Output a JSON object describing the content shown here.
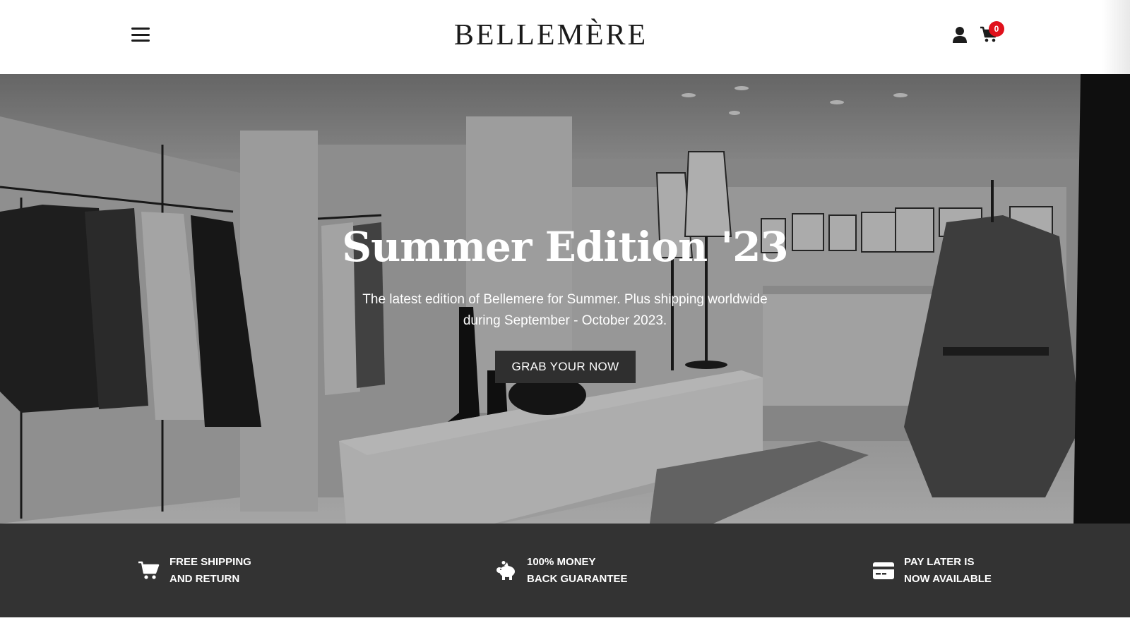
{
  "header": {
    "brand": "BELLEMÈRE",
    "menu_icon": "hamburger-menu-icon",
    "user_icon": "user-icon",
    "cart_icon": "shopping-cart-icon",
    "cart_count": "0"
  },
  "hero": {
    "title": "Summer Edition '23",
    "subtitle_line1": "The latest edition of Bellemere for Summer. Plus shipping worldwide",
    "subtitle_line2": "during September - October 2023.",
    "cta_label": "GRAB YOUR NOW"
  },
  "features": [
    {
      "icon": "cart-icon",
      "line1": "FREE SHIPPING",
      "line2": "AND RETURN"
    },
    {
      "icon": "piggy-bank-icon",
      "line1": "100% MONEY",
      "line2": "BACK GUARANTEE"
    },
    {
      "icon": "credit-card-icon",
      "line1": "PAY LATER IS",
      "line2": "NOW AVAILABLE"
    }
  ],
  "colors": {
    "badge": "#e0101b",
    "feature_band": "#333333",
    "cta_background": "#2f2f2f",
    "text_dark": "#1a1a1a"
  }
}
